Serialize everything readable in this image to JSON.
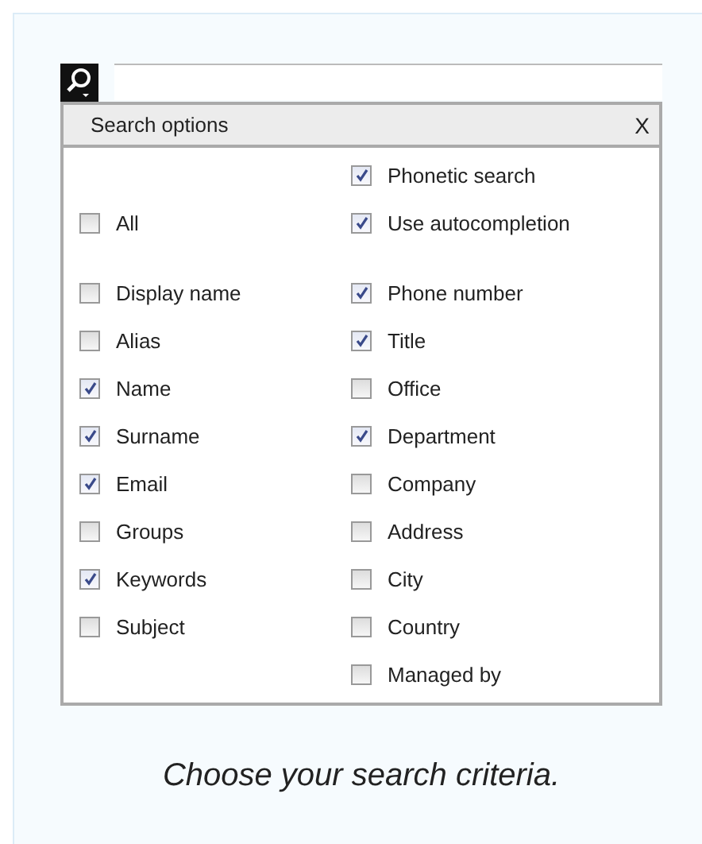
{
  "panel": {
    "title": "Search options",
    "close": "X"
  },
  "options": {
    "left": [
      {
        "label": "All",
        "checked": false
      }
    ],
    "right": [
      {
        "label": "Phonetic search",
        "checked": true
      },
      {
        "label": "Use autocompletion",
        "checked": true
      }
    ]
  },
  "fields": {
    "left": [
      {
        "label": "Display name",
        "checked": false
      },
      {
        "label": "Alias",
        "checked": false
      },
      {
        "label": "Name",
        "checked": true
      },
      {
        "label": "Surname",
        "checked": true
      },
      {
        "label": "Email",
        "checked": true
      },
      {
        "label": "Groups",
        "checked": false
      },
      {
        "label": "Keywords",
        "checked": true
      },
      {
        "label": "Subject",
        "checked": false
      }
    ],
    "right": [
      {
        "label": "Phone number",
        "checked": true
      },
      {
        "label": "Title",
        "checked": true
      },
      {
        "label": "Office",
        "checked": false
      },
      {
        "label": "Department",
        "checked": true
      },
      {
        "label": "Company",
        "checked": false
      },
      {
        "label": "Address",
        "checked": false
      },
      {
        "label": "City",
        "checked": false
      },
      {
        "label": "Country",
        "checked": false
      },
      {
        "label": "Managed by",
        "checked": false
      }
    ]
  },
  "caption": "Choose your search criteria."
}
